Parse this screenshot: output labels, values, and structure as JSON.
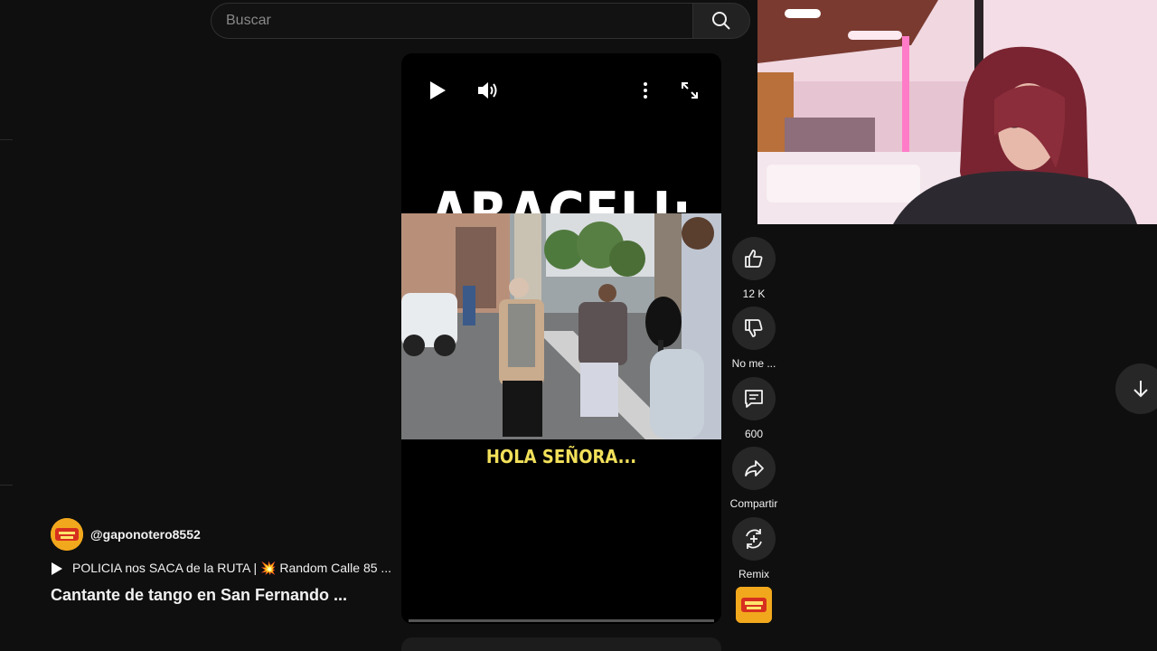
{
  "search": {
    "placeholder": "Buscar"
  },
  "caption": {
    "top": "ARACELI:",
    "bottom": "HOLA SEÑORA..."
  },
  "actions": {
    "like_count": "12 K",
    "dislike_label": "No me ...",
    "comments_count": "600",
    "share_label": "Compartir",
    "remix_label": "Remix"
  },
  "channel": {
    "handle": "@gaponotero8552",
    "avatar_text": "GAPO"
  },
  "playlist": {
    "text": "POLICIA nos SACA de la RUTA | 💥 Random Calle 85 ..."
  },
  "video": {
    "title": "Cantante de tango en San Fernando ..."
  },
  "colors": {
    "accent_caption": "#f2e05a",
    "background": "#0f0f0f",
    "button_bg": "#272727"
  },
  "icons": {
    "search": "search-icon",
    "play": "play-icon",
    "volume": "volume-icon",
    "more": "more-vertical-icon",
    "fullscreen": "fullscreen-icon",
    "like": "thumbs-up-icon",
    "dislike": "thumbs-down-icon",
    "comment": "comment-icon",
    "share": "share-icon",
    "remix": "remix-icon",
    "down": "arrow-down-icon"
  }
}
